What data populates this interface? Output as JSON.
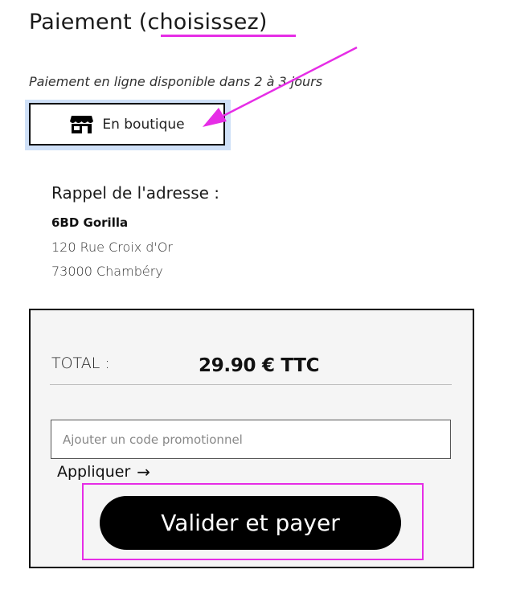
{
  "payment": {
    "title": "Paiement (choisissez)",
    "online_notice": "Paiement en ligne disponible dans 2 à 3 jours",
    "option_label": "En boutique",
    "option_icon": "store-icon"
  },
  "address": {
    "title": "Rappel de l'adresse :",
    "name": "6BD Gorilla",
    "street": "120 Rue Croix d'Or",
    "city": "73000 Chambéry"
  },
  "summary": {
    "total_label": "TOTAL :",
    "total_value": "29.90 € TTC",
    "promo_placeholder": "Ajouter un code promotionnel",
    "apply_label": "Appliquer",
    "apply_icon": "→",
    "pay_label": "Valider et payer"
  },
  "colors": {
    "annotation": "#e62de6",
    "selected_outline": "#cfe0f7",
    "button_bg": "#000000"
  }
}
